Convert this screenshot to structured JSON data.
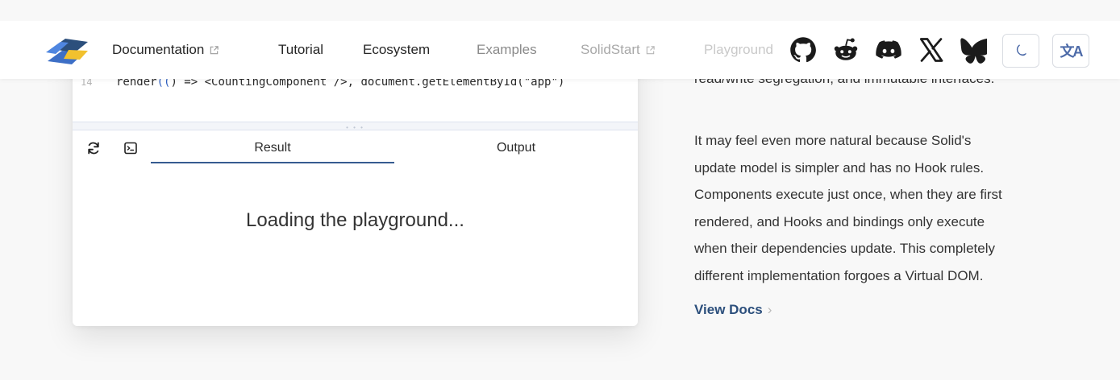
{
  "header": {
    "nav": [
      {
        "label": "Documentation",
        "external": true
      },
      {
        "label": "Tutorial",
        "external": false
      },
      {
        "label": "Ecosystem",
        "external": false
      },
      {
        "label": "Examples",
        "external": false
      },
      {
        "label": "SolidStart",
        "external": true
      },
      {
        "label": "Playground",
        "external": false
      }
    ],
    "social_icons": [
      "github-icon",
      "reddit-icon",
      "discord-icon",
      "x-icon",
      "bluesky-icon"
    ],
    "theme_icon": "moon-icon",
    "language_icon": "translate-icon",
    "language_glyph": "文A"
  },
  "playground": {
    "line_number": "14",
    "code_parts": [
      "render",
      "((",
      ") => <CountingComponent />, document.getElementById(",
      "\"app\"",
      ")"
    ],
    "tabs": [
      {
        "label": "Result",
        "active": true
      },
      {
        "label": "Output",
        "active": false
      }
    ],
    "loading_text": "Loading the playground..."
  },
  "content": {
    "clipped_line": "read/write segregation, and immutable interfaces.",
    "paragraph_lines": [
      "It may feel even more natural because Solid's",
      "update model is simpler and has no Hook rules.",
      "Components execute just once, when they are first",
      "rendered, and Hooks and bindings only execute",
      "when their dependencies update. This completely",
      "different implementation forgoes a Virtual DOM."
    ],
    "link_label": "View Docs",
    "link_chevron": "›"
  },
  "colors": {
    "accent": "#2c4f7c",
    "tab_underline": "#365b90",
    "logo_blue": "#3d6fc6",
    "logo_yellow": "#f2c12e"
  }
}
